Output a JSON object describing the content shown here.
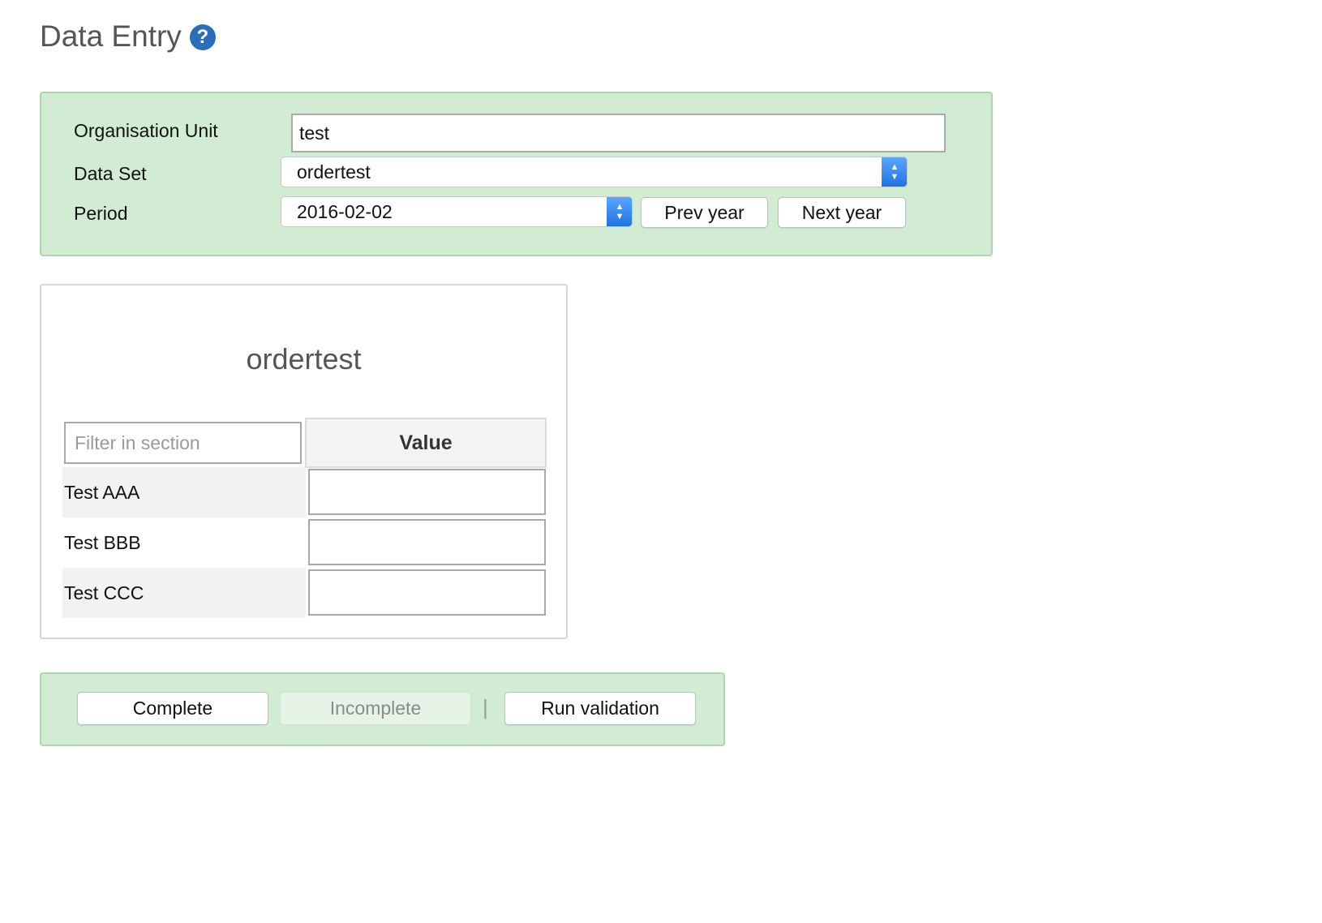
{
  "header": {
    "title": "Data Entry",
    "help_glyph": "?"
  },
  "selection": {
    "org_unit_label": "Organisation Unit",
    "org_unit_value": "test",
    "data_set_label": "Data Set",
    "data_set_value": "ordertest",
    "period_label": "Period",
    "period_value": "2016-02-02",
    "prev_year_label": "Prev year",
    "next_year_label": "Next year"
  },
  "form": {
    "title": "ordertest",
    "filter_placeholder": "Filter in section",
    "value_header": "Value",
    "rows": [
      {
        "label": "Test AAA",
        "value": ""
      },
      {
        "label": "Test BBB",
        "value": ""
      },
      {
        "label": "Test CCC",
        "value": ""
      }
    ]
  },
  "actions": {
    "complete_label": "Complete",
    "incomplete_label": "Incomplete",
    "separator": "|",
    "run_validation_label": "Run validation"
  },
  "colors": {
    "panel_bg": "#d2ecd3",
    "panel_border": "#a9d9ab",
    "help_icon": "#2a6ebb",
    "select_accent": "#1f72e0"
  }
}
